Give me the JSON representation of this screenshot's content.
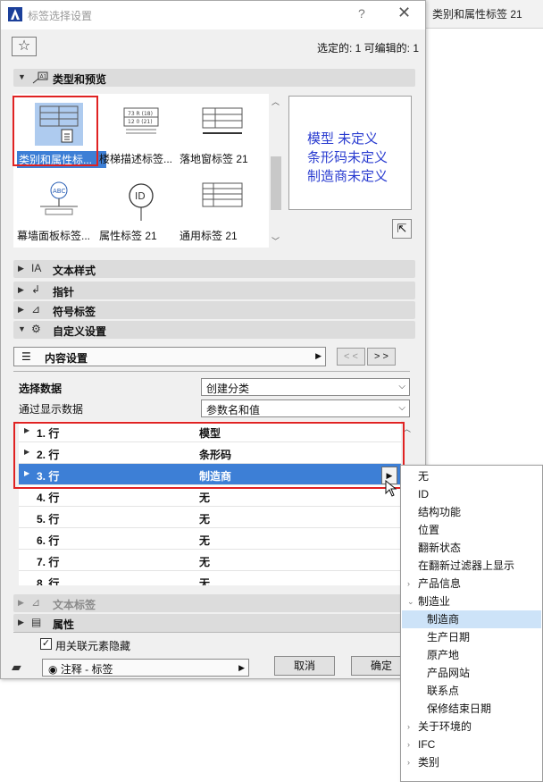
{
  "background_window": {
    "title": "类别和属性标签 21"
  },
  "dialog": {
    "title": "标签选择设置",
    "help_label": "?",
    "close_label": "✕",
    "favorites_label": "☆",
    "selection_info": "选定的: 1 可编辑的: 1"
  },
  "sections": {
    "type_preview": "类型和预览",
    "text_style": "文本样式",
    "pointer": "指针",
    "symbol_label": "符号标签",
    "custom_settings": "自定义设置",
    "text_label": "文本标签",
    "properties": "属性"
  },
  "gallery": {
    "items": [
      {
        "label": "类别和属性标...",
        "icon": "category-property-label-icon",
        "selected": true
      },
      {
        "label": "楼梯描述标签...",
        "icon": "stair-description-label-icon",
        "selected": false
      },
      {
        "label": "落地窗标签 21",
        "icon": "french-window-label-icon",
        "selected": false
      },
      {
        "label": "幕墙面板标签...",
        "icon": "curtain-wall-panel-label-icon",
        "selected": false
      },
      {
        "label": "属性标签 21",
        "icon": "property-label-icon",
        "selected": false
      },
      {
        "label": "通用标签 21",
        "icon": "general-label-icon",
        "selected": false
      }
    ],
    "id_badge": "ID",
    "abc_badge": "ABC"
  },
  "preview": {
    "lines": [
      "模型    未定义",
      "条形码未定义",
      "制造商未定义"
    ],
    "text_color": "#2a3cd0"
  },
  "content": {
    "bar_label": "内容设置",
    "prev_label": "< <",
    "next_label": "> >",
    "select_data_label": "选择数据",
    "select_data_value": "创建分类",
    "display_via_label": "通过显示数据",
    "display_via_value": "参数名和值"
  },
  "table": {
    "rows": [
      {
        "label": "1. 行",
        "value": "模型",
        "expandable": true
      },
      {
        "label": "2. 行",
        "value": "条形码",
        "expandable": true
      },
      {
        "label": "3. 行",
        "value": "制造商",
        "expandable": true,
        "selected": true
      },
      {
        "label": "4. 行",
        "value": "无",
        "expandable": false
      },
      {
        "label": "5. 行",
        "value": "无",
        "expandable": false
      },
      {
        "label": "6. 行",
        "value": "无",
        "expandable": false
      },
      {
        "label": "7. 行",
        "value": "无",
        "expandable": false
      },
      {
        "label": "8. 行",
        "value": "无",
        "expandable": false
      }
    ],
    "highlight_color": "#3d7fd6"
  },
  "footer": {
    "hide_checkbox_label": "用关联元素隐藏",
    "hide_checked": true,
    "layer_value": "注释 - 标签",
    "cancel_label": "取消",
    "ok_label": "确定"
  },
  "menu": {
    "items": [
      {
        "label": "无",
        "level": 0,
        "expander": ""
      },
      {
        "label": "ID",
        "level": 0,
        "expander": ""
      },
      {
        "label": "结构功能",
        "level": 0,
        "expander": ""
      },
      {
        "label": "位置",
        "level": 0,
        "expander": ""
      },
      {
        "label": "翻新状态",
        "level": 0,
        "expander": ""
      },
      {
        "label": "在翻新过滤器上显示",
        "level": 0,
        "expander": ""
      },
      {
        "label": "产品信息",
        "level": 0,
        "expander": "›"
      },
      {
        "label": "制造业",
        "level": 0,
        "expander": "⌄"
      },
      {
        "label": "制造商",
        "level": 1,
        "expander": "",
        "highlighted": true
      },
      {
        "label": "生产日期",
        "level": 1,
        "expander": ""
      },
      {
        "label": "原产地",
        "level": 1,
        "expander": ""
      },
      {
        "label": "产品网站",
        "level": 1,
        "expander": ""
      },
      {
        "label": "联系点",
        "level": 1,
        "expander": ""
      },
      {
        "label": "保修结束日期",
        "level": 1,
        "expander": ""
      },
      {
        "label": "关于环境的",
        "level": 0,
        "expander": "›"
      },
      {
        "label": "IFC",
        "level": 0,
        "expander": "›"
      },
      {
        "label": "类别",
        "level": 0,
        "expander": "›"
      }
    ]
  },
  "accent_red": "#e02222"
}
